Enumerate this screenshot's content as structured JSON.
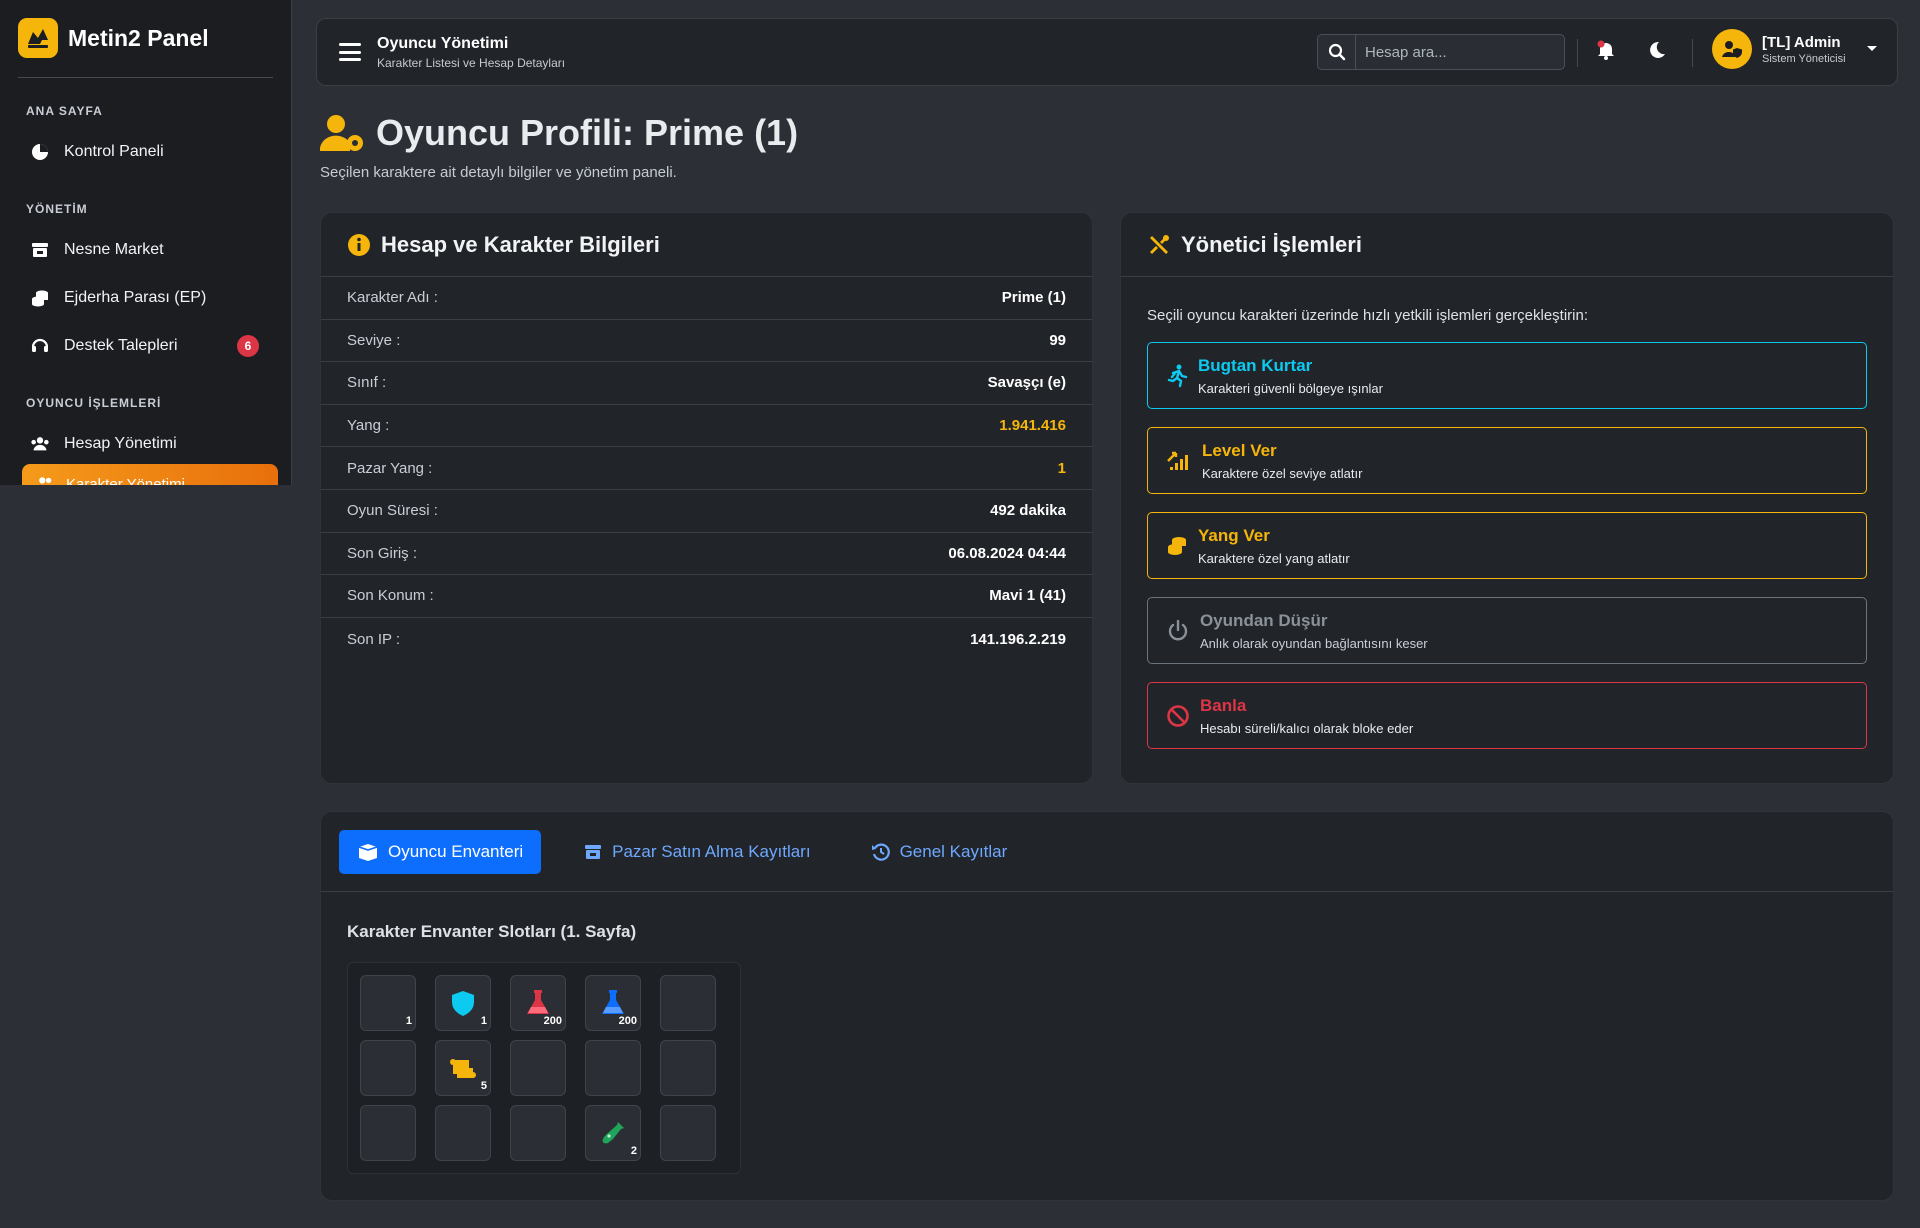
{
  "brand": {
    "name": "Metin2 Panel"
  },
  "sidebar": {
    "sections": [
      {
        "title": "ANA SAYFA",
        "items": [
          {
            "label": "Kontrol Paneli",
            "icon": "dashboard-icon"
          }
        ]
      },
      {
        "title": "YÖNETİM",
        "items": [
          {
            "label": "Nesne Market",
            "icon": "store-icon"
          },
          {
            "label": "Ejderha Parası (EP)",
            "icon": "coins-icon"
          },
          {
            "label": "Destek Talepleri",
            "icon": "headset-icon",
            "badge": "6"
          }
        ]
      },
      {
        "title": "OYUNCU İŞLEMLERİ",
        "items": [
          {
            "label": "Hesap Yönetimi",
            "icon": "users-icon"
          }
        ]
      }
    ],
    "active_item": "Karakter Yönetimi"
  },
  "topbar": {
    "title": "Oyuncu Yönetimi",
    "subtitle": "Karakter Listesi ve Hesap Detayları",
    "search_placeholder": "Hesap ara...",
    "user_name": "[TL] Admin",
    "user_role": "Sistem Yöneticisi"
  },
  "page": {
    "title": "Oyuncu Profili: Prime (1)",
    "subtitle": "Seçilen karaktere ait detaylı bilgiler ve yönetim paneli."
  },
  "account_card": {
    "title": "Hesap ve Karakter Bilgileri",
    "rows": [
      {
        "label": "Karakter Adı :",
        "value": "Prime (1)"
      },
      {
        "label": "Seviye :",
        "value": "99"
      },
      {
        "label": "Sınıf :",
        "value": "Savaşçı (e)"
      },
      {
        "label": "Yang :",
        "value": "1.941.416",
        "highlight": "gold"
      },
      {
        "label": "Pazar Yang :",
        "value": "1",
        "highlight": "gold"
      },
      {
        "label": "Oyun Süresi :",
        "value": "492 dakika"
      },
      {
        "label": "Son Giriş :",
        "value": "06.08.2024 04:44"
      },
      {
        "label": "Son Konum :",
        "value": "Mavi 1 (41)"
      },
      {
        "label": "Son IP :",
        "value": "141.196.2.219"
      }
    ]
  },
  "admin_card": {
    "title": "Yönetici İşlemleri",
    "intro": "Seçili oyuncu karakteri üzerinde hızlı yetkili işlemleri gerçekleştirin:",
    "actions": [
      {
        "title": "Bugtan Kurtar",
        "desc": "Karakteri güvenli bölgeye ışınlar",
        "color": "#0dcaf0"
      },
      {
        "title": "Level Ver",
        "desc": "Karaktere özel seviye atlatır",
        "color": "#f5b50a"
      },
      {
        "title": "Yang Ver",
        "desc": "Karaktere özel yang atlatır",
        "color": "#f5b50a"
      },
      {
        "title": "Oyundan Düşür",
        "desc": "Anlık olarak oyundan bağlantısını keser",
        "color": "#6c757d"
      },
      {
        "title": "Banla",
        "desc": "Hesabı süreli/kalıcı olarak bloke eder",
        "color": "#dc3545"
      }
    ]
  },
  "tabs": [
    {
      "label": "Oyuncu Envanteri",
      "active": true
    },
    {
      "label": "Pazar Satın Alma Kayıtları",
      "active": false
    },
    {
      "label": "Genel Kayıtlar",
      "active": false
    }
  ],
  "inventory": {
    "title": "Karakter Envanter Slotları (1. Sayfa)",
    "slots": [
      {
        "icon": "",
        "qty": "1"
      },
      {
        "icon": "shield-icon",
        "qty": "1"
      },
      {
        "icon": "red-potion-icon",
        "qty": "200"
      },
      {
        "icon": "blue-potion-icon",
        "qty": "200"
      },
      {
        "icon": "",
        "qty": ""
      },
      {
        "icon": "",
        "qty": ""
      },
      {
        "icon": "scroll-icon",
        "qty": "5"
      },
      {
        "icon": "",
        "qty": ""
      },
      {
        "icon": "",
        "qty": ""
      },
      {
        "icon": "",
        "qty": ""
      },
      {
        "icon": "",
        "qty": ""
      },
      {
        "icon": "",
        "qty": ""
      },
      {
        "icon": "",
        "qty": ""
      },
      {
        "icon": "bottle-icon",
        "qty": "2"
      },
      {
        "icon": "",
        "qty": ""
      }
    ]
  },
  "colors": {
    "accent": "#f5b50a",
    "primary": "#0d6efd",
    "danger": "#dc3545",
    "info": "#0dcaf0"
  }
}
